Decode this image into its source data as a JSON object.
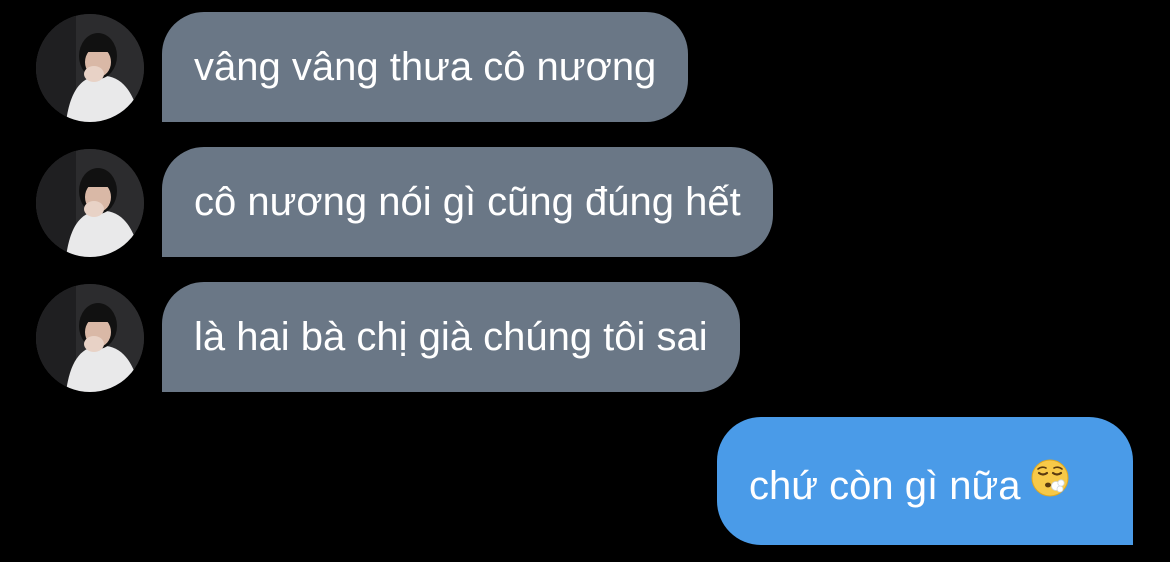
{
  "conversation": {
    "messages": [
      {
        "sender": "other",
        "text": "vâng vâng thưa cô nương"
      },
      {
        "sender": "other",
        "text": "cô nương nói gì cũng đúng hết"
      },
      {
        "sender": "other",
        "text": "là hai bà chị già chúng tôi sai"
      },
      {
        "sender": "self",
        "text": "chứ còn gì nữa",
        "emoji": "face-exhaling-emoji"
      }
    ]
  },
  "colors": {
    "background": "#000000",
    "incoming_bubble": "#6a7786",
    "outgoing_bubble": "#4a9be8",
    "text": "#ffffff"
  }
}
